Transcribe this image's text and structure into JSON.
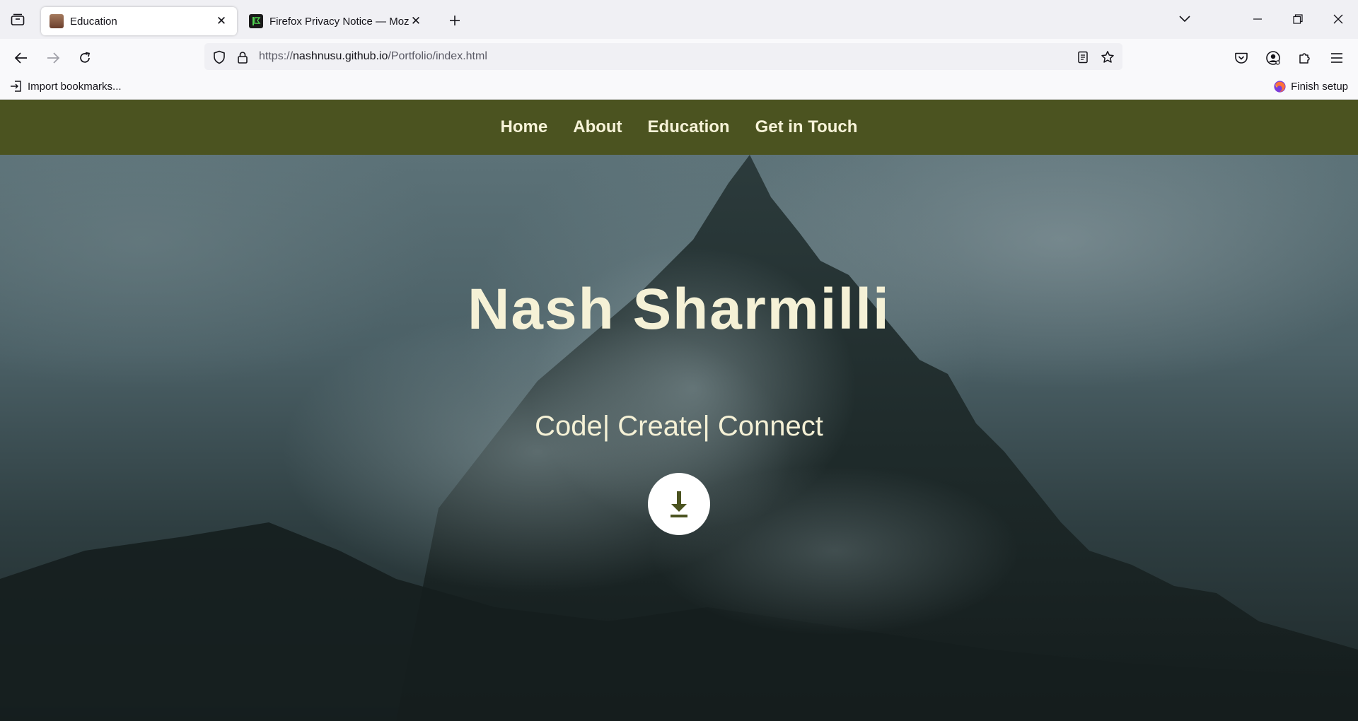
{
  "browser": {
    "tabs": [
      {
        "title": "Education",
        "active": true
      },
      {
        "title": "Firefox Privacy Notice — Mozilla",
        "active": false
      }
    ],
    "url": {
      "scheme": "https://",
      "host": "nashnusu.github.io",
      "path": "/Portfolio/index.html"
    },
    "bookmarks": {
      "import_label": "Import bookmarks...",
      "finish_setup_label": "Finish setup"
    }
  },
  "site": {
    "nav": [
      "Home",
      "About",
      "Education",
      "Get in Touch"
    ],
    "hero": {
      "name": "Nash Sharmilli",
      "tagline": "Code| Create| Connect",
      "download_icon": "download-arrow-icon"
    },
    "colors": {
      "nav_bg": "#4b5320",
      "nav_text": "#f7f3d8",
      "hero_text": "#f5f1d6",
      "button_bg": "#ffffff",
      "button_icon": "#4b5320"
    }
  }
}
